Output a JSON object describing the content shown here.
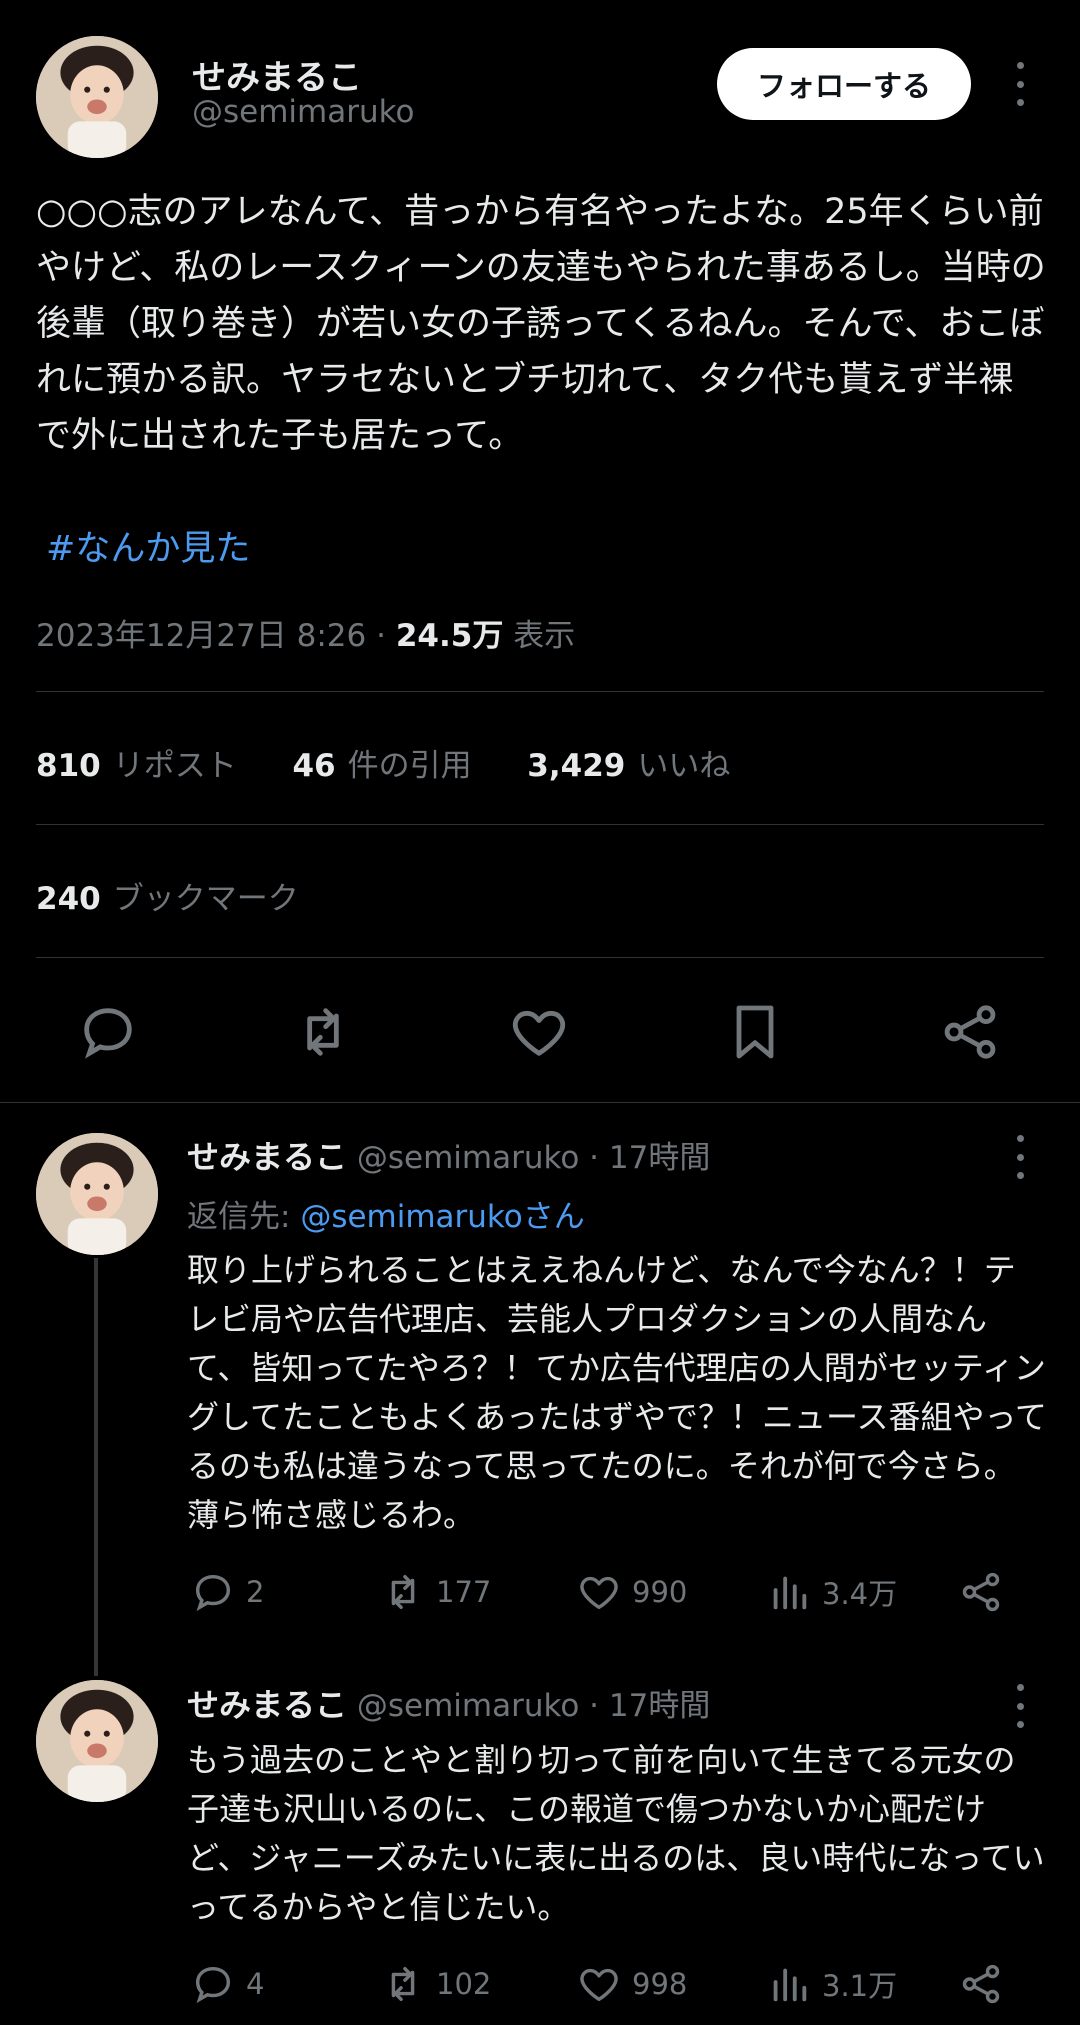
{
  "post": {
    "display_name": "せみまるこ",
    "handle": "@semimaruko",
    "follow_label": "フォローする",
    "text": "○○○志のアレなんて、昔っから有名やったよな。25年くらい前やけど、私のレースクィーンの友達もやられた事あるし。当時の後輩（取り巻き）が若い女の子誘ってくるねん。そんで、おこぼれに預かる訳。ヤラセないとブチ切れて、タク代も貰えず半裸で外に出された子も居たって。",
    "hashtag": "#なんか見た",
    "timestamp": "2023年12月27日 8:26",
    "separator": " · ",
    "views_count": "24.5万",
    "views_label": "表示",
    "reposts_count": "810",
    "reposts_label": "リポスト",
    "quotes_count": "46",
    "quotes_label": "件の引用",
    "likes_count": "3,429",
    "likes_label": "いいね",
    "bookmarks_count": "240",
    "bookmarks_label": "ブックマーク"
  },
  "replies": [
    {
      "display_name": "せみまるこ",
      "handle": "@semimaruko",
      "time": "· 17時間",
      "reply_to_prefix": "返信先: ",
      "reply_to_handle": "@semimarukoさん",
      "text": "取り上げられることはええねんけど、なんで今なん？！テレビ局や広告代理店、芸能人プロダクションの人間なんて、皆知ってたやろ？！てか広告代理店の人間がセッティングしてたこともよくあったはずやで？！ニュース番組やってるのも私は違うなって思ってたのに。それが何で今さら。薄ら怖さ感じるわ。",
      "reply_count": "2",
      "repost_count": "177",
      "like_count": "990",
      "view_count": "3.4万"
    },
    {
      "display_name": "せみまるこ",
      "handle": "@semimaruko",
      "time": "· 17時間",
      "text": "もう過去のことやと割り切って前を向いて生きてる元女の子達も沢山いるのに、この報道で傷つかないか心配だけど、ジャニーズみたいに表に出るのは、良い時代になっていってるからやと信じたい。",
      "reply_count": "4",
      "repost_count": "102",
      "like_count": "998",
      "view_count": "3.1万"
    }
  ],
  "colors": {
    "background": "#000000",
    "text": "#e7e9ea",
    "muted": "#71767b",
    "link": "#4c9bf0",
    "divider": "#2f3336"
  },
  "icons": [
    "reply-icon",
    "repost-icon",
    "like-icon",
    "bookmark-icon",
    "share-icon",
    "views-icon",
    "more-icon"
  ]
}
